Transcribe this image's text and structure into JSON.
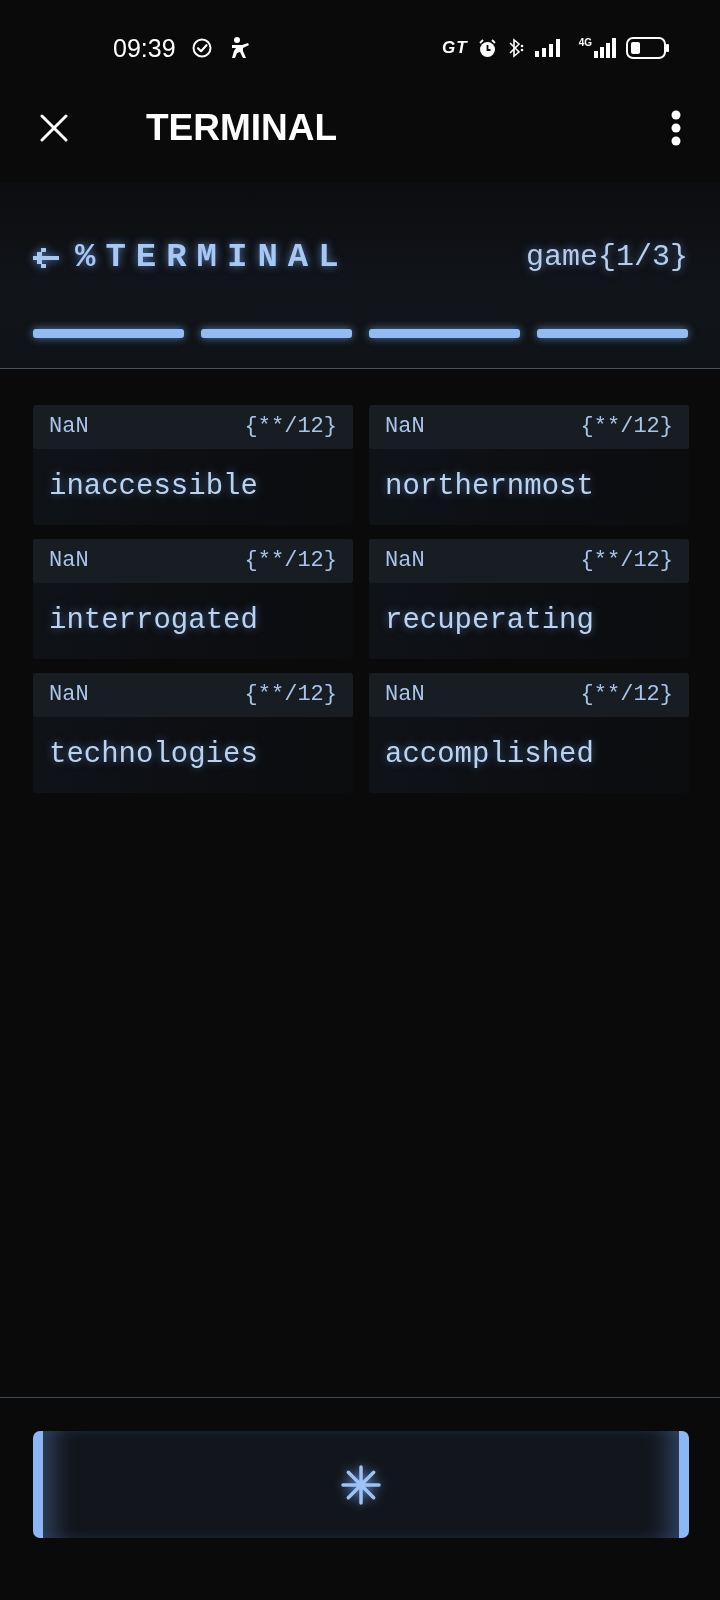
{
  "status_bar": {
    "time": "09:39",
    "network_badge": "GT",
    "network_type": "4G"
  },
  "app_bar": {
    "title": "TERMINAL"
  },
  "game_header": {
    "title": "%TERMINAL",
    "progress_label": "game{1/3}",
    "segments": [
      {
        "on": true
      },
      {
        "on": true
      },
      {
        "on": true
      },
      {
        "on": true
      }
    ]
  },
  "words": [
    {
      "score": "NaN",
      "count": "{**/12}",
      "word": "inaccessible"
    },
    {
      "score": "NaN",
      "count": "{**/12}",
      "word": "northernmost"
    },
    {
      "score": "NaN",
      "count": "{**/12}",
      "word": "interrogated"
    },
    {
      "score": "NaN",
      "count": "{**/12}",
      "word": "recuperating"
    },
    {
      "score": "NaN",
      "count": "{**/12}",
      "word": "technologies"
    },
    {
      "score": "NaN",
      "count": "{**/12}",
      "word": "accomplished"
    }
  ]
}
